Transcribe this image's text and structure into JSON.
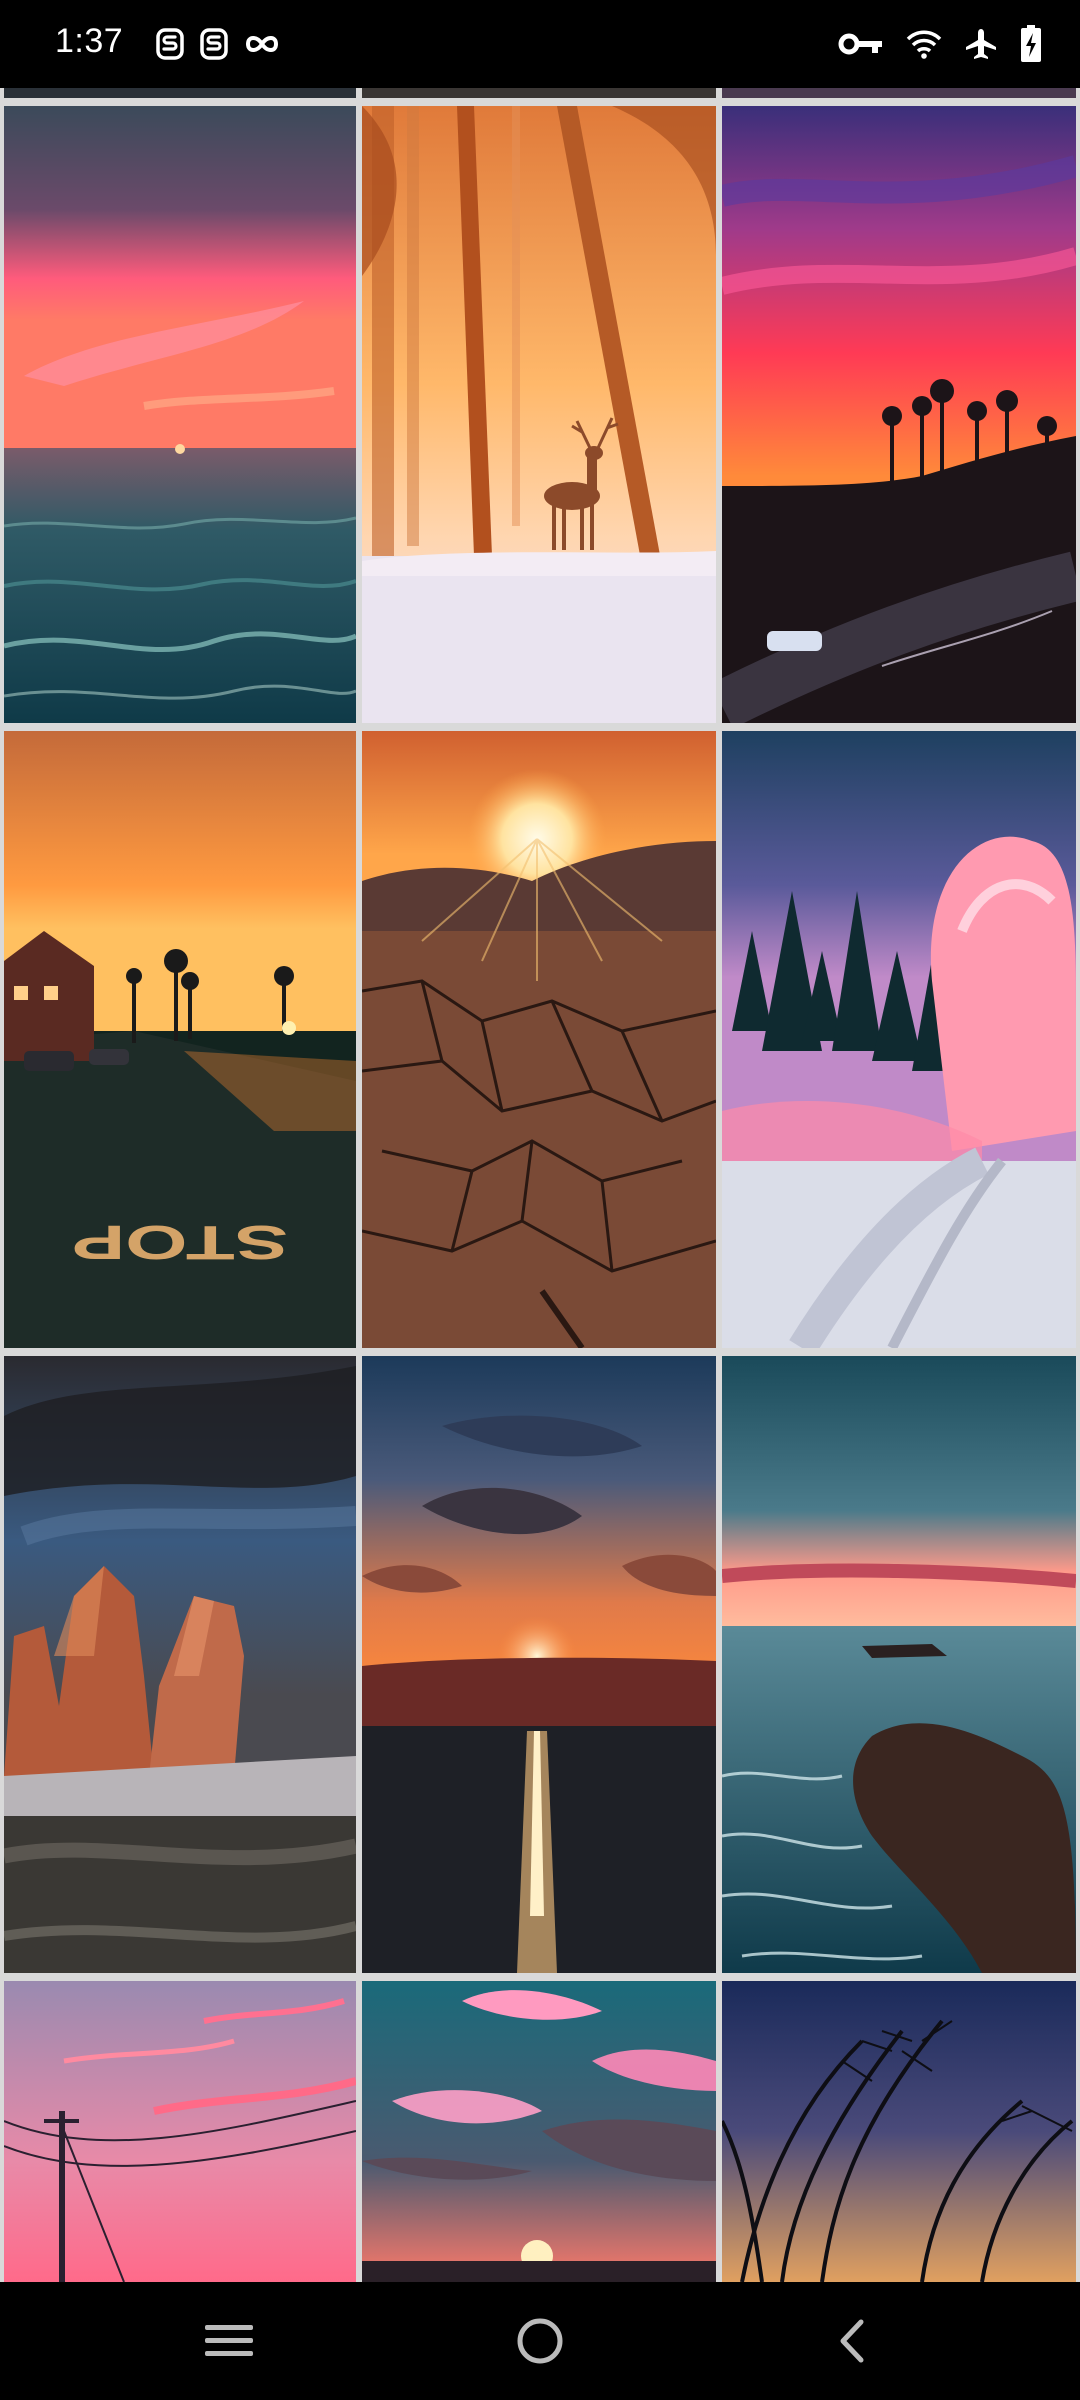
{
  "status_bar": {
    "time": "1:37",
    "left_icons": [
      "s-badge-icon",
      "s-badge-icon",
      "infinity-icon"
    ],
    "right_icons": [
      "vpn-key-icon",
      "wifi-icon",
      "airplane-mode-icon",
      "battery-charging-icon"
    ]
  },
  "gallery": {
    "columns": 3,
    "items": [
      {
        "name": "wallpaper-peek-1"
      },
      {
        "name": "wallpaper-peek-2"
      },
      {
        "name": "wallpaper-peek-3"
      },
      {
        "name": "wallpaper-ocean-sunset"
      },
      {
        "name": "wallpaper-deer-misty-forest"
      },
      {
        "name": "wallpaper-palm-sunset-road"
      },
      {
        "name": "wallpaper-stop-road-sunset"
      },
      {
        "name": "wallpaper-cracked-earth-sunburst"
      },
      {
        "name": "wallpaper-pink-snowy-trees"
      },
      {
        "name": "wallpaper-dolomites-peaks"
      },
      {
        "name": "wallpaper-sunset-sea-reflection"
      },
      {
        "name": "wallpaper-rocky-coast-waves"
      },
      {
        "name": "wallpaper-powerline-pink-sky"
      },
      {
        "name": "wallpaper-pink-clouds-sunset"
      },
      {
        "name": "wallpaper-grass-silhouette"
      }
    ],
    "stop_road_text": "STOP"
  },
  "nav_bar": {
    "buttons": [
      "menu-icon",
      "home-icon",
      "back-icon"
    ]
  }
}
